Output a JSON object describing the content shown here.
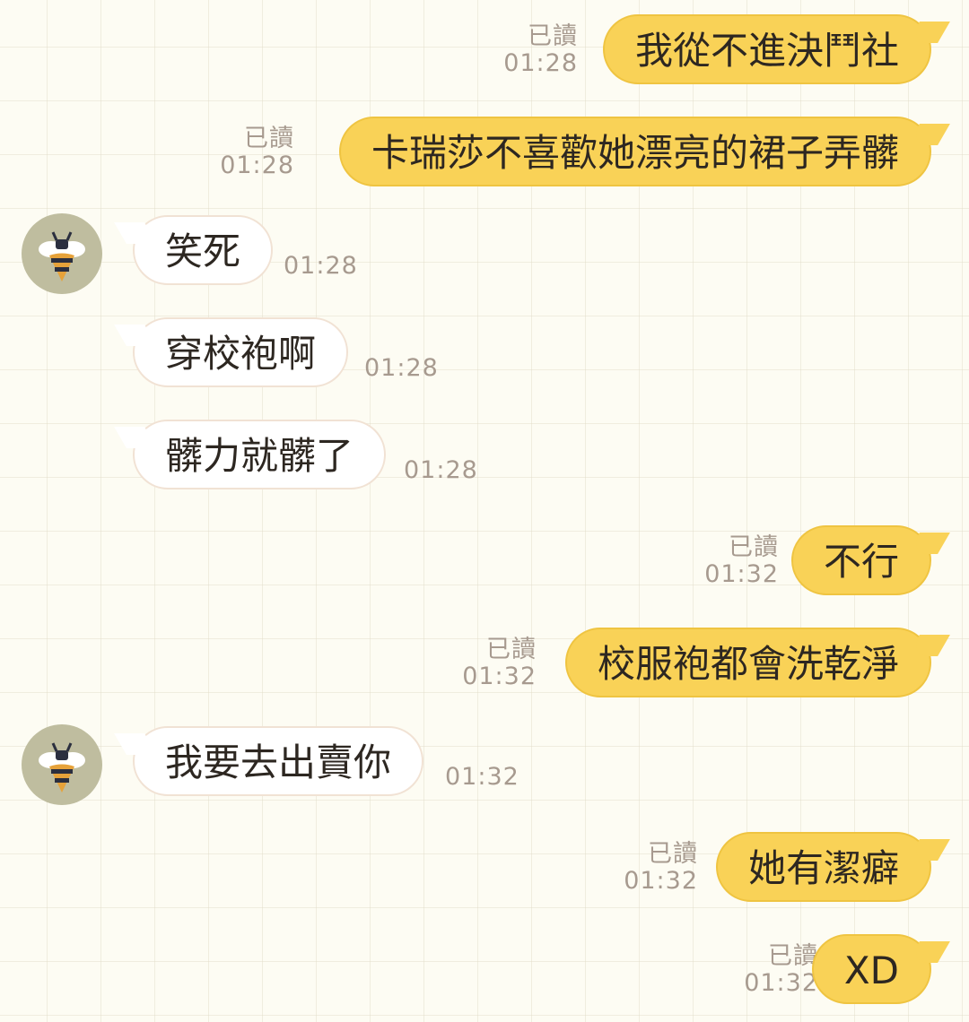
{
  "conversation": {
    "messages": [
      {
        "side": "sent",
        "text": "我從不進決鬥社",
        "read": "已讀",
        "time": "01:28"
      },
      {
        "side": "sent",
        "text": "卡瑞莎不喜歡她漂亮的裙子弄髒",
        "read": "已讀",
        "time": "01:28"
      },
      {
        "side": "recv",
        "text": "笑死",
        "time": "01:28",
        "avatar": "bee-icon"
      },
      {
        "side": "recv",
        "text": "穿校袍啊",
        "time": "01:28"
      },
      {
        "side": "recv",
        "text": "髒力就髒了",
        "time": "01:28"
      },
      {
        "side": "sent",
        "text": "不行",
        "read": "已讀",
        "time": "01:32"
      },
      {
        "side": "sent",
        "text": "校服袍都會洗乾淨",
        "read": "已讀",
        "time": "01:32"
      },
      {
        "side": "recv",
        "text": "我要去出賣你",
        "time": "01:32",
        "avatar": "bee-icon"
      },
      {
        "side": "sent",
        "text": "她有潔癖",
        "read": "已讀",
        "time": "01:32"
      },
      {
        "side": "sent",
        "text": "XD",
        "read": "已讀",
        "time": "01:32"
      }
    ]
  },
  "colors": {
    "sent_bubble": "#f9d257",
    "recv_bubble": "#ffffff",
    "meta_text": "#a79a8f",
    "avatar_bg": "#bfbd9f",
    "background": "#fdfcf3"
  }
}
